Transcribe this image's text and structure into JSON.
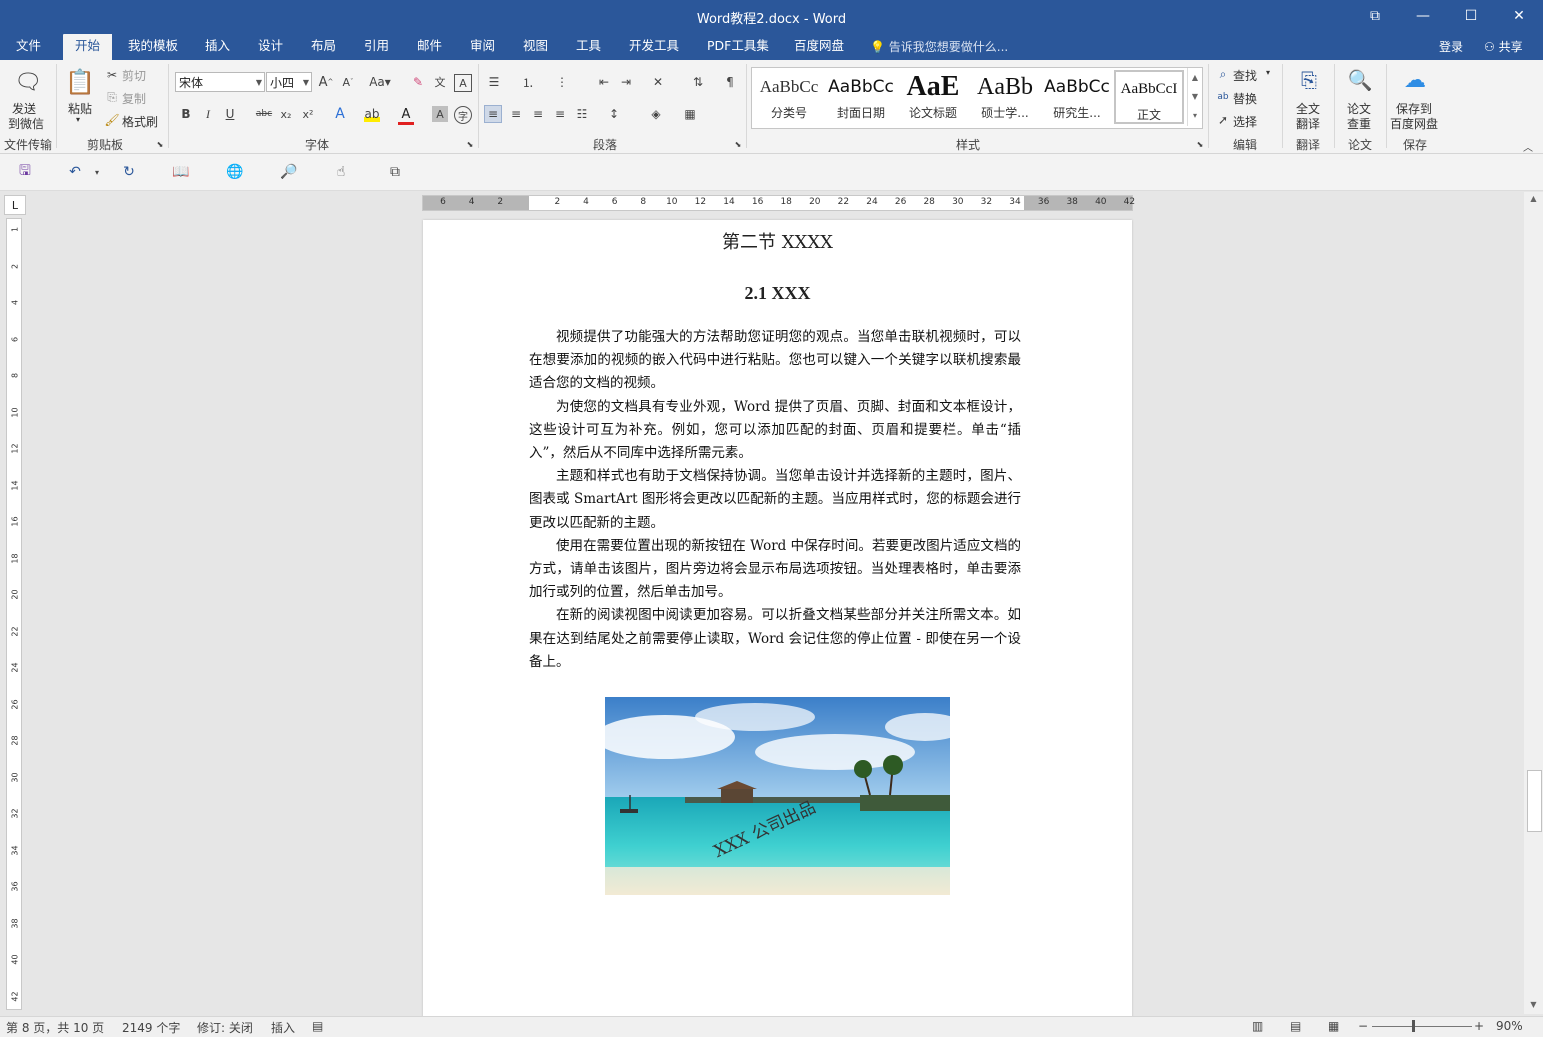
{
  "window": {
    "title": "Word教程2.docx - Word"
  },
  "tabs": [
    {
      "label": "文件"
    },
    {
      "label": "开始"
    },
    {
      "label": "我的模板"
    },
    {
      "label": "插入"
    },
    {
      "label": "设计"
    },
    {
      "label": "布局"
    },
    {
      "label": "引用"
    },
    {
      "label": "邮件"
    },
    {
      "label": "审阅"
    },
    {
      "label": "视图"
    },
    {
      "label": "工具"
    },
    {
      "label": "开发工具"
    },
    {
      "label": "PDF工具集"
    },
    {
      "label": "百度网盘"
    }
  ],
  "tell_me": "告诉我您想要做什么...",
  "account": {
    "login": "登录",
    "share": "共享"
  },
  "ribbon": {
    "file_transfer": {
      "send_line1": "发送",
      "send_line2": "到微信",
      "group": "文件传输"
    },
    "clipboard": {
      "paste": "粘贴",
      "cut": "剪切",
      "copy": "复制",
      "format_painter": "格式刷",
      "group": "剪贴板"
    },
    "font": {
      "name": "宋体",
      "size": "小四",
      "group": "字体"
    },
    "paragraph": {
      "group": "段落"
    },
    "styles": {
      "group": "样式",
      "items": [
        {
          "sample": "AaBbCc",
          "name": "分类号"
        },
        {
          "sample": "AaBbCc",
          "name": "封面日期"
        },
        {
          "sample": "AaE",
          "name": "论文标题"
        },
        {
          "sample": "AaBb",
          "name": "硕士学..."
        },
        {
          "sample": "AaBbCc",
          "name": "研究生..."
        },
        {
          "sample": "AaBbCcI",
          "name": "正文"
        }
      ]
    },
    "editing": {
      "find": "查找",
      "replace": "替换",
      "select": "选择",
      "group": "编辑"
    },
    "translate": {
      "line1": "全文",
      "line2": "翻译",
      "group": "翻译"
    },
    "thesis": {
      "line1": "论文",
      "line2": "查重",
      "group": "论文"
    },
    "save": {
      "line1": "保存到",
      "line2": "百度网盘",
      "group": "保存"
    }
  },
  "ruler": {
    "h_labels": [
      "6",
      "4",
      "2",
      "",
      "2",
      "4",
      "6",
      "8",
      "10",
      "12",
      "14",
      "16",
      "18",
      "20",
      "22",
      "24",
      "26",
      "28",
      "30",
      "32",
      "34",
      "36",
      "38",
      "40",
      "42"
    ],
    "v_labels": [
      "1",
      "2",
      "4",
      "6",
      "8",
      "10",
      "12",
      "14",
      "16",
      "18",
      "20",
      "22",
      "24",
      "26",
      "28",
      "30",
      "32",
      "34",
      "36",
      "38",
      "40",
      "42"
    ]
  },
  "document": {
    "section_title": "第二节  XXXX",
    "heading": "2.1 XXX",
    "paragraphs": [
      "视频提供了功能强大的方法帮助您证明您的观点。当您单击联机视频时，可以在想要添加的视频的嵌入代码中进行粘贴。您也可以键入一个关键字以联机搜索最适合您的文档的视频。",
      "为使您的文档具有专业外观，Word 提供了页眉、页脚、封面和文本框设计，这些设计可互为补充。例如，您可以添加匹配的封面、页眉和提要栏。单击“插入”，然后从不同库中选择所需元素。",
      "主题和样式也有助于文档保持协调。当您单击设计并选择新的主题时，图片、图表或 SmartArt 图形将会更改以匹配新的主题。当应用样式时，您的标题会进行更改以匹配新的主题。",
      "使用在需要位置出现的新按钮在 Word 中保存时间。若要更改图片适应文档的方式，请单击该图片，图片旁边将会显示布局选项按钮。当处理表格时，单击要添加行或列的位置，然后单击加号。",
      "在新的阅读视图中阅读更加容易。可以折叠文档某些部分并关注所需文本。如果在达到结尾处之前需要停止读取，Word 会记住您的停止位置 - 即使在另一个设备上。"
    ],
    "image_watermark": "XXX 公司出品"
  },
  "status": {
    "page": "第 8 页，共 10 页",
    "words": "2149 个字",
    "track": "修订: 关闭",
    "insert": "插入",
    "zoom": "90%"
  },
  "colors": {
    "brand": "#2b579a",
    "ribbon_bg": "#f3f3f3"
  }
}
